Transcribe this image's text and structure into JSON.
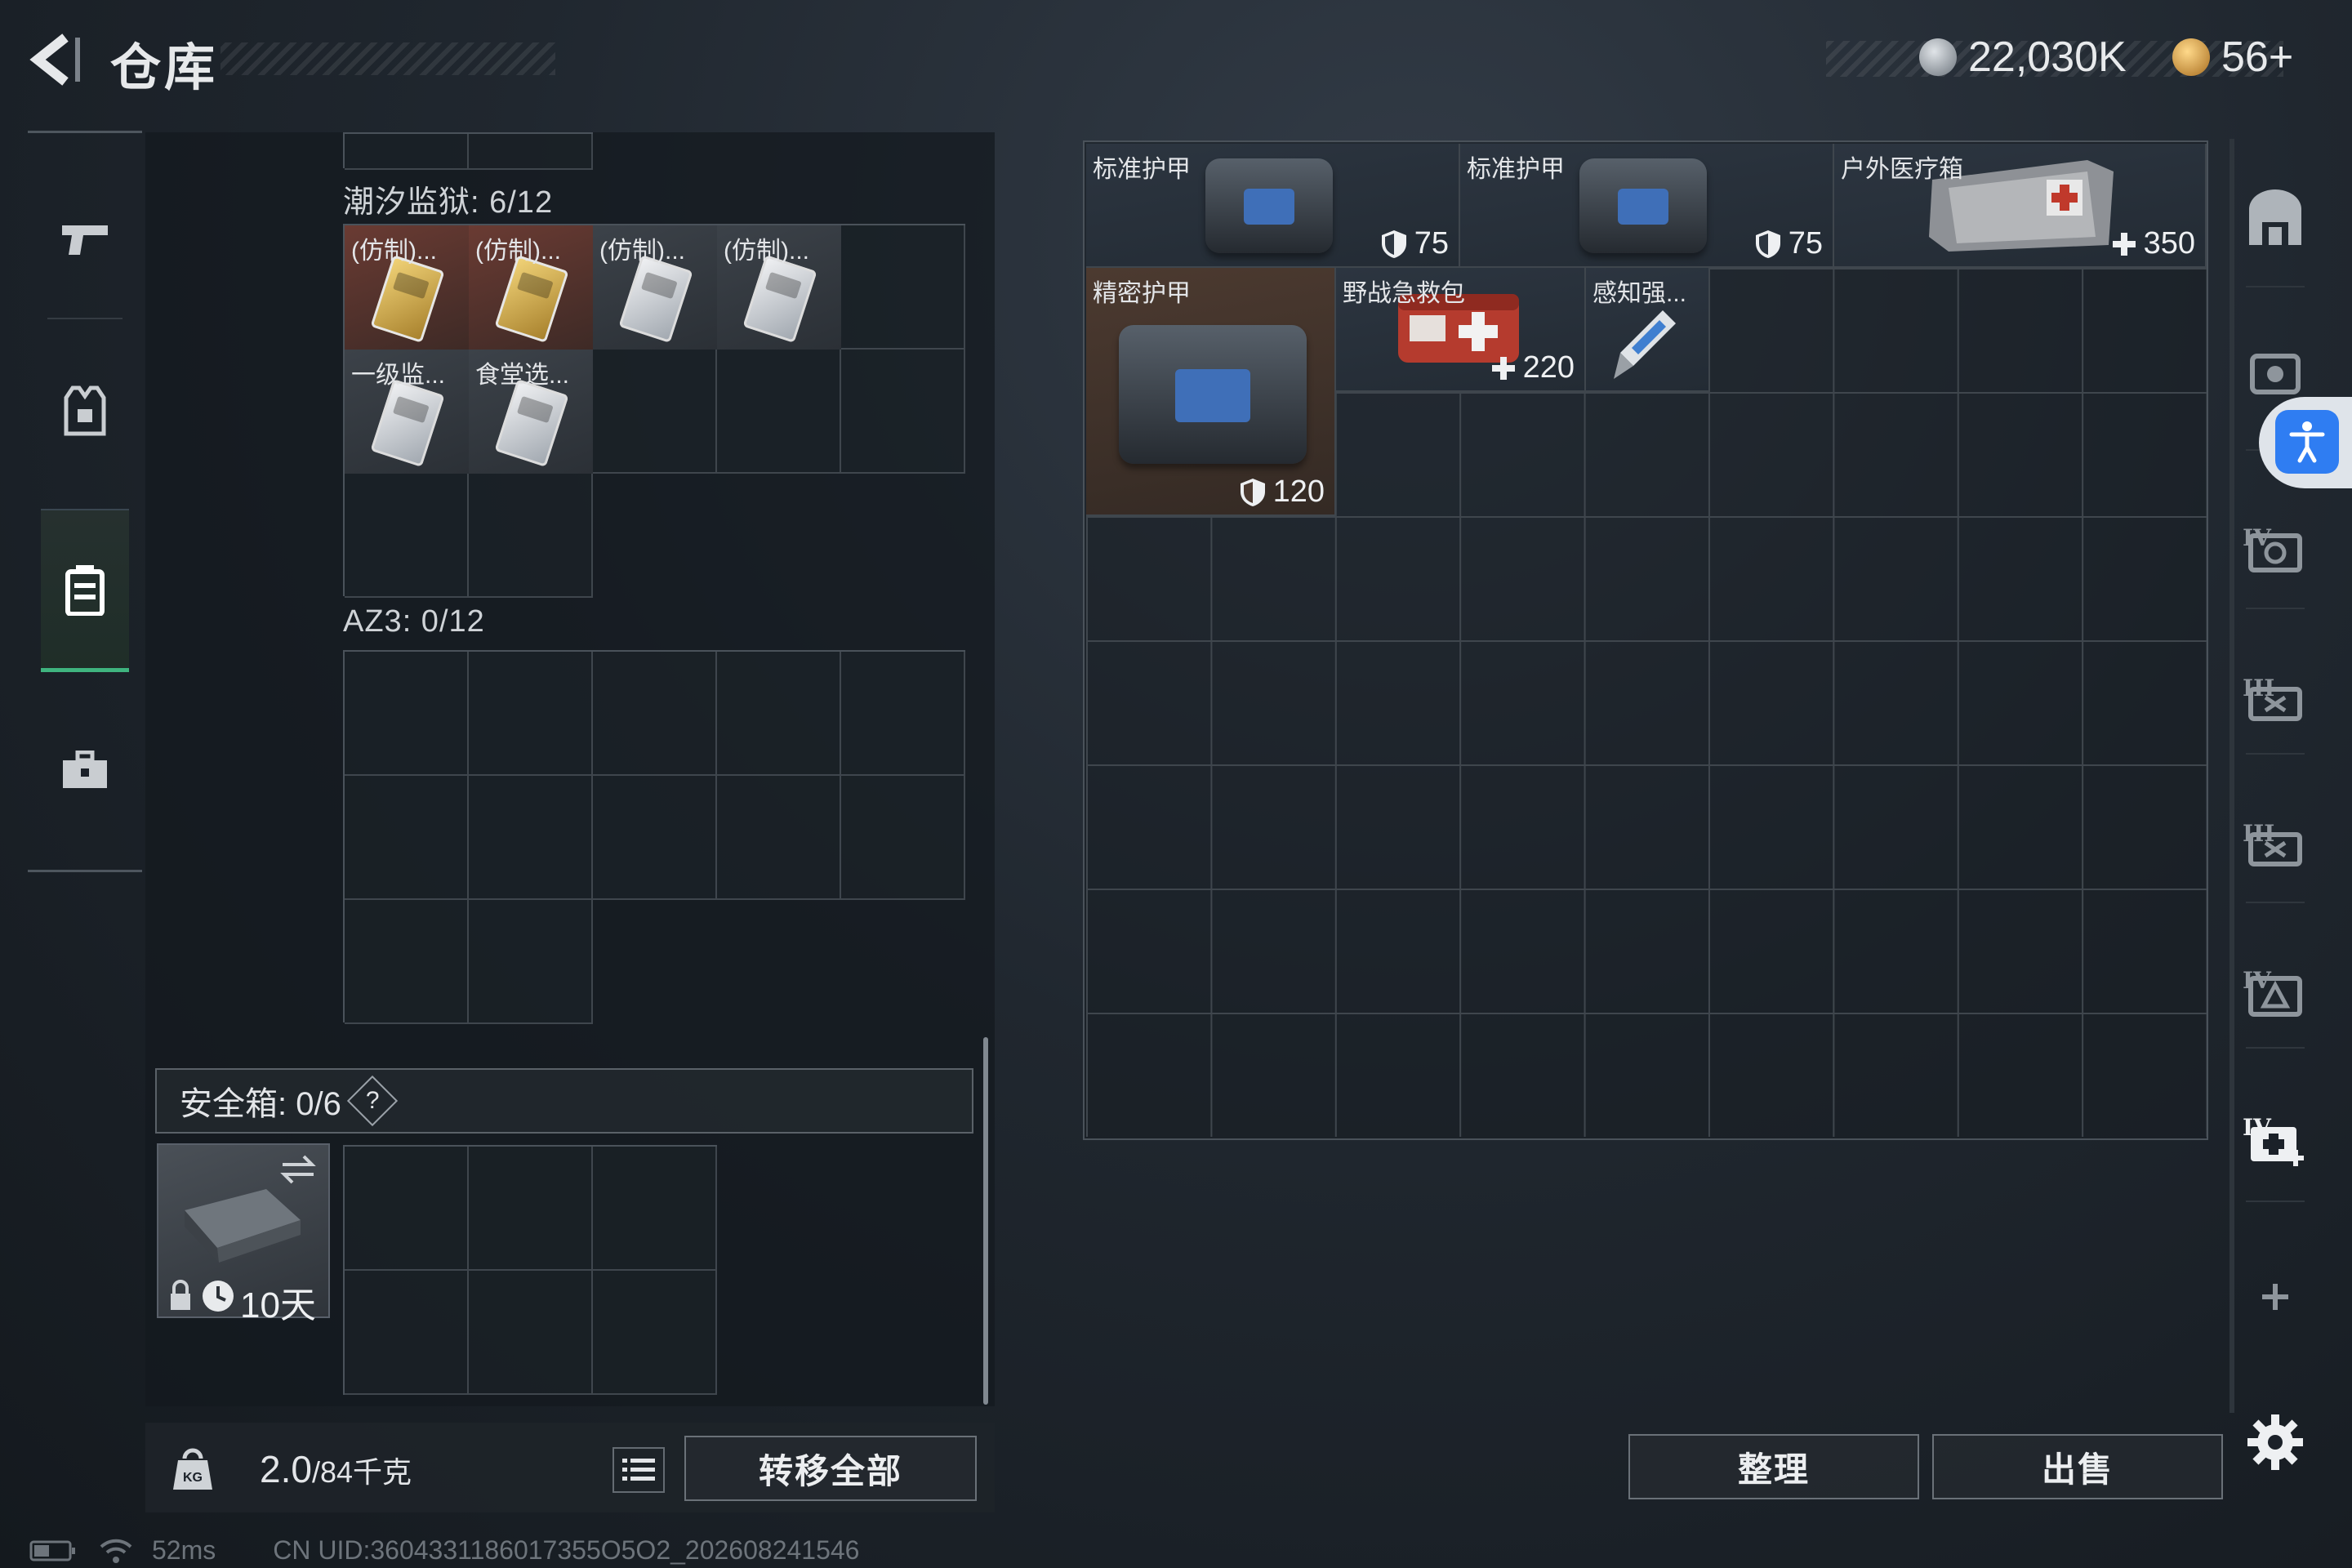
{
  "header": {
    "title": "仓库",
    "currency_a": "22,030K",
    "currency_b": "56+"
  },
  "left_sections": {
    "tidal_prison_label": "潮汐监狱: 6/12",
    "tidal_items": [
      "(仿制)...",
      "(仿制)...",
      "(仿制)...",
      "(仿制)...",
      "一级监...",
      "食堂选..."
    ],
    "az3_label": "AZ3: 0/12"
  },
  "safe_box": {
    "label": "安全箱:  0/6",
    "help": "?",
    "timer": "10天"
  },
  "bottom": {
    "weight_current": "2.0",
    "weight_max": "/84千克",
    "transfer_all": "转移全部",
    "sort": "整理",
    "sell": "出售"
  },
  "stash_items": [
    {
      "name": "标准护甲",
      "value": "75"
    },
    {
      "name": "标准护甲",
      "value": "75"
    },
    {
      "name": "户外医疗箱",
      "value": "350"
    },
    {
      "name": "精密护甲",
      "value": "120"
    },
    {
      "name": "野战急救包",
      "value": "220"
    },
    {
      "name": "感知强..."
    }
  ],
  "right_nav": {
    "tab_labels": [
      "IV",
      "III",
      "III",
      "IV",
      "IV"
    ]
  },
  "status_bar": {
    "ping": "52ms",
    "uid": "CN UID:3604331186017355O5O2_202608241546"
  },
  "colors": {
    "accent_green": "#3fb47f",
    "accessibility_blue": "#2f7df2"
  }
}
